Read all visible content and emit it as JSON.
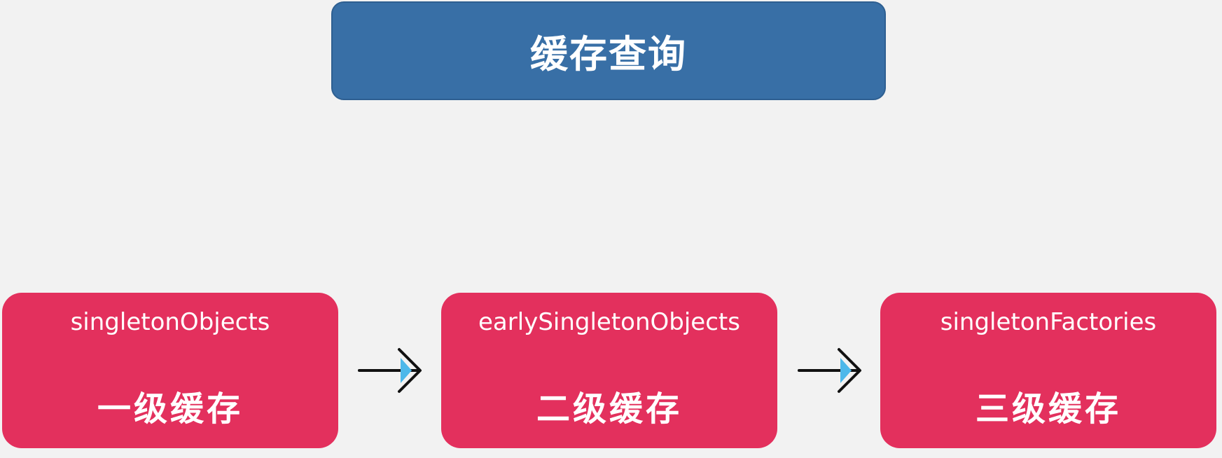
{
  "header": {
    "title": "缓存查询"
  },
  "caches": [
    {
      "name": "singletonObjects",
      "level": "一级缓存"
    },
    {
      "name": "earlySingletonObjects",
      "level": "二级缓存"
    },
    {
      "name": "singletonFactories",
      "level": "三级缓存"
    }
  ],
  "colors": {
    "background": "#f2f2f2",
    "header_fill": "#386fa6",
    "cache_fill": "#e3305d",
    "arrow_accent": "#4db8ea",
    "arrow_line": "#111111",
    "text": "#ffffff"
  },
  "icons": [
    "arrow-right-icon",
    "arrow-right-icon"
  ]
}
